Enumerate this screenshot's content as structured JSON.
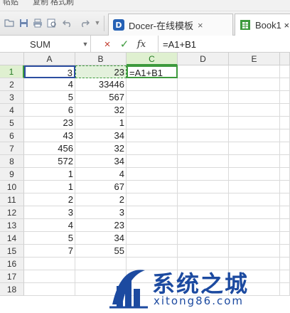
{
  "ribbon": {
    "left_text": "帖贴",
    "mid_text": "复制 格式刷"
  },
  "quick_access": {
    "icons": [
      "folder-icon",
      "save-icon",
      "print-icon",
      "preview-icon",
      "undo-icon",
      "redo-icon"
    ]
  },
  "tabs": [
    {
      "label": "Docer-在线模板",
      "icon": "docer-logo-icon",
      "close": "×"
    },
    {
      "label": "Book1 ×",
      "icon": "spreadsheet-icon"
    }
  ],
  "formula_bar": {
    "name_box": "SUM",
    "cancel": "×",
    "confirm": "✓",
    "fx": "fx",
    "formula": "=A1+B1"
  },
  "columns": [
    "A",
    "B",
    "C",
    "D",
    "E"
  ],
  "rows": [
    "1",
    "2",
    "3",
    "4",
    "5",
    "6",
    "7",
    "8",
    "9",
    "10",
    "11",
    "12",
    "13",
    "14",
    "15",
    "16",
    "17",
    "18"
  ],
  "column_a": [
    "3",
    "4",
    "5",
    "6",
    "23",
    "43",
    "456",
    "572",
    "1",
    "1",
    "2",
    "3",
    "4",
    "5",
    "7",
    "",
    "",
    ""
  ],
  "column_b": [
    "23",
    "33446",
    "567",
    "32",
    "1",
    "34",
    "32",
    "34",
    "4",
    "67",
    "2",
    "3",
    "23",
    "34",
    "55",
    "",
    "",
    ""
  ],
  "editing_cell": {
    "value": "=A1+B1"
  },
  "watermark": {
    "title": "系统之城",
    "subtitle": "xitong86.com"
  },
  "colors": {
    "accent_green": "#3d9a3d",
    "selection_blue": "#2c4ea0",
    "watermark_blue": "#1c4aa0"
  }
}
